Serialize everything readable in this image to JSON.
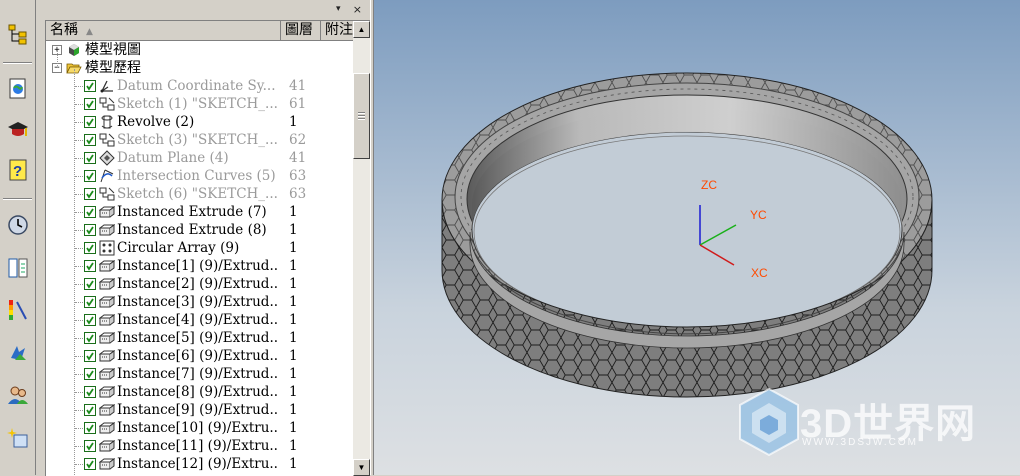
{
  "header": {
    "col_name": "名稱",
    "col_layer": "圖層",
    "col_note": "附注"
  },
  "tree": {
    "model_views": "模型視圖",
    "model_history": "模型歷程"
  },
  "features": [
    {
      "name": "Datum Coordinate Sy...",
      "layer": "41",
      "state": "dim",
      "icon": "datum-csys-icon"
    },
    {
      "name": "Sketch (1) \"SKETCH_...",
      "layer": "61",
      "state": "dim",
      "icon": "sketch-icon"
    },
    {
      "name": "Revolve (2)",
      "layer": "1",
      "state": "active",
      "icon": "revolve-icon"
    },
    {
      "name": "Sketch (3) \"SKETCH_...",
      "layer": "62",
      "state": "dim",
      "icon": "sketch-icon"
    },
    {
      "name": "Datum Plane (4)",
      "layer": "41",
      "state": "dim",
      "icon": "datum-plane-icon"
    },
    {
      "name": "Intersection Curves (5)",
      "layer": "63",
      "state": "dim",
      "icon": "intersection-curve-icon"
    },
    {
      "name": "Sketch (6) \"SKETCH_...",
      "layer": "63",
      "state": "dim",
      "icon": "sketch-icon"
    },
    {
      "name": "Instanced Extrude (7)",
      "layer": "1",
      "state": "active",
      "icon": "extrude-icon"
    },
    {
      "name": "Instanced Extrude (8)",
      "layer": "1",
      "state": "active",
      "icon": "extrude-icon"
    },
    {
      "name": "Circular Array (9)",
      "layer": "1",
      "state": "active",
      "icon": "array-icon"
    },
    {
      "name": "Instance[1] (9)/Extrud...",
      "layer": "1",
      "state": "active",
      "icon": "extrude-icon"
    },
    {
      "name": "Instance[2] (9)/Extrud...",
      "layer": "1",
      "state": "active",
      "icon": "extrude-icon"
    },
    {
      "name": "Instance[3] (9)/Extrud...",
      "layer": "1",
      "state": "active",
      "icon": "extrude-icon"
    },
    {
      "name": "Instance[4] (9)/Extrud...",
      "layer": "1",
      "state": "active",
      "icon": "extrude-icon"
    },
    {
      "name": "Instance[5] (9)/Extrud...",
      "layer": "1",
      "state": "active",
      "icon": "extrude-icon"
    },
    {
      "name": "Instance[6] (9)/Extrud...",
      "layer": "1",
      "state": "active",
      "icon": "extrude-icon"
    },
    {
      "name": "Instance[7] (9)/Extrud...",
      "layer": "1",
      "state": "active",
      "icon": "extrude-icon"
    },
    {
      "name": "Instance[8] (9)/Extrud...",
      "layer": "1",
      "state": "active",
      "icon": "extrude-icon"
    },
    {
      "name": "Instance[9] (9)/Extrud...",
      "layer": "1",
      "state": "active",
      "icon": "extrude-icon"
    },
    {
      "name": "Instance[10] (9)/Extru...",
      "layer": "1",
      "state": "active",
      "icon": "extrude-icon"
    },
    {
      "name": "Instance[11] (9)/Extru...",
      "layer": "1",
      "state": "active",
      "icon": "extrude-icon"
    },
    {
      "name": "Instance[12] (9)/Extru...",
      "layer": "1",
      "state": "active",
      "icon": "extrude-icon"
    }
  ],
  "axes": {
    "z": "ZC",
    "y": "YC",
    "x": "XC"
  },
  "watermark": {
    "brand": "3D世界网",
    "url": "WWW.3DSJW.COM"
  },
  "resource_bar": [
    "part-navigator-icon",
    "web-browser-icon",
    "roles-icon",
    "help-icon",
    "history-icon",
    "reuse-library-icon",
    "palette-icon",
    "assembly-navigator-icon",
    "user-icon",
    "new-item-icon"
  ],
  "colors": {
    "panel": "#d4d0c8",
    "check": "#1a8a1a",
    "dim_text": "#9a9a9a",
    "axis_label": "#ff4a00"
  }
}
